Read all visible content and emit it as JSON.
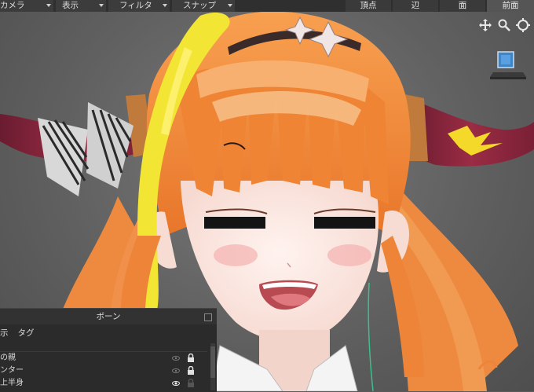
{
  "menubar": {
    "items": [
      {
        "label": "カメラ"
      },
      {
        "label": "表示"
      },
      {
        "label": "フィルタ"
      },
      {
        "label": "スナップ"
      }
    ]
  },
  "view_tabs": [
    {
      "label": "頂点",
      "active": false
    },
    {
      "label": "辺",
      "active": false
    },
    {
      "label": "面",
      "active": false
    },
    {
      "label": "前面",
      "active": true
    }
  ],
  "nav_icons": [
    "move-icon",
    "zoom-icon",
    "rotate-icon"
  ],
  "bone_panel": {
    "title": "ボーン",
    "menu": [
      "示",
      "タグ"
    ],
    "rows": [
      {
        "label": "の親",
        "visible": false,
        "locked": true
      },
      {
        "label": "ンター",
        "visible": false,
        "locked": true
      },
      {
        "label": "上半身",
        "visible": true,
        "locked": false
      }
    ]
  },
  "colors": {
    "hair": "#f08a3c",
    "hair_streak": "#f4e83a",
    "horn": "#8a2438",
    "skin": "#fbe6df",
    "panel_bg": "#2b2b2b",
    "menubar_bg": "#2f2f2f"
  }
}
